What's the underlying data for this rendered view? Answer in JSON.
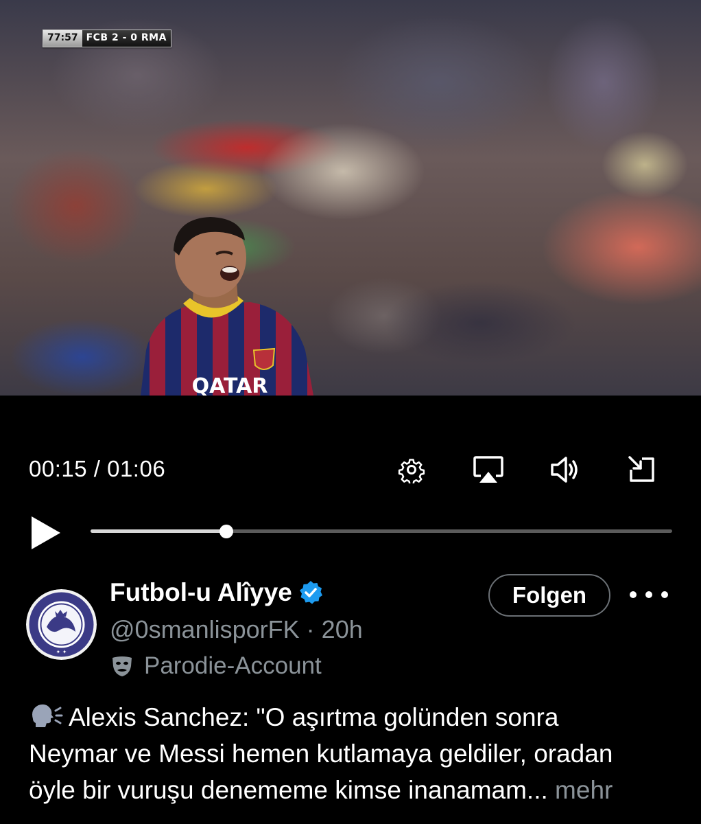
{
  "video": {
    "scoreboard": {
      "clock": "77:57",
      "score": "FCB 2 - 0 RMA"
    },
    "jersey_sponsor": "QATAR",
    "time_display": "00:15 / 01:06",
    "progress_fraction": 0.233,
    "icons": {
      "settings": "gear-icon",
      "airplay": "airplay-icon",
      "volume": "speaker-icon",
      "exit_fullscreen": "minimize-icon",
      "play": "play-icon"
    }
  },
  "post": {
    "author": {
      "display_name": "Futbol-u Alîyye",
      "verified": true,
      "handle": "@0smanlisporFK",
      "separator": "·",
      "time_ago": "20h",
      "account_label": "Parodie-Account"
    },
    "follow_label": "Folgen",
    "text_lines": [
      "Alexis Sanchez: \"O aşırtma golünden sonra",
      "Neymar ve Messi hemen kutlamaya geldiler, oradan",
      "öyle bir vuruşu denememe kimse inanamam..."
    ],
    "more_label": "mehr"
  },
  "colors": {
    "background": "#000000",
    "verified_badge": "#1d9bf0",
    "secondary_text": "#8b9399",
    "progress_fill": "#d7d7d7",
    "progress_track": "#5b5b5b"
  }
}
